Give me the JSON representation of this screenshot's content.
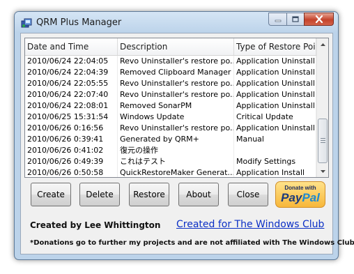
{
  "window": {
    "title": "QRM Plus Manager",
    "controls": [
      "minimize-icon",
      "maximize-icon",
      "close-icon"
    ]
  },
  "table": {
    "columns": [
      "Date and Time",
      "Description",
      "Type of Restore Point"
    ],
    "rows": [
      [
        "2010/06/24 22:04:05",
        "Revo Uninstaller's restore po...",
        "Application Uninstall"
      ],
      [
        "2010/06/24 22:04:39",
        "Removed Clipboard Manager",
        "Application Uninstall"
      ],
      [
        "2010/06/24 22:05:55",
        "Revo Uninstaller's restore po...",
        "Application Uninstall"
      ],
      [
        "2010/06/24 22:07:40",
        "Revo Uninstaller's restore po...",
        "Application Uninstall"
      ],
      [
        "2010/06/24 22:08:01",
        "Removed SonarPM",
        "Application Uninstall"
      ],
      [
        "2010/06/25 15:31:54",
        "Windows Update",
        "Critical Update"
      ],
      [
        "2010/06/26 0:16:56",
        "Revo Uninstaller's restore po...",
        "Application Uninstall"
      ],
      [
        "2010/06/26 0:39:41",
        "Generated by QRM+",
        "Manual"
      ],
      [
        "2010/06/26 0:41:02",
        "復元の操作",
        ""
      ],
      [
        "2010/06/26 0:49:39",
        "これはテスト",
        "Modify Settings"
      ],
      [
        "2010/06/26 0:50:58",
        "QuickRestoreMaker Generat...",
        "Application Install"
      ]
    ]
  },
  "buttons": {
    "create": "Create",
    "delete": "Delete",
    "restore": "Restore",
    "about": "About",
    "close": "Close"
  },
  "paypal": {
    "top": "Donate with",
    "pay": "Pay",
    "pal": "Pal"
  },
  "footer": {
    "created_by": "Created by Lee Whittington",
    "created_for": "Created for The Windows Club",
    "note": "*Donations go to further my projects and are not affiliated with The Windows Club"
  }
}
